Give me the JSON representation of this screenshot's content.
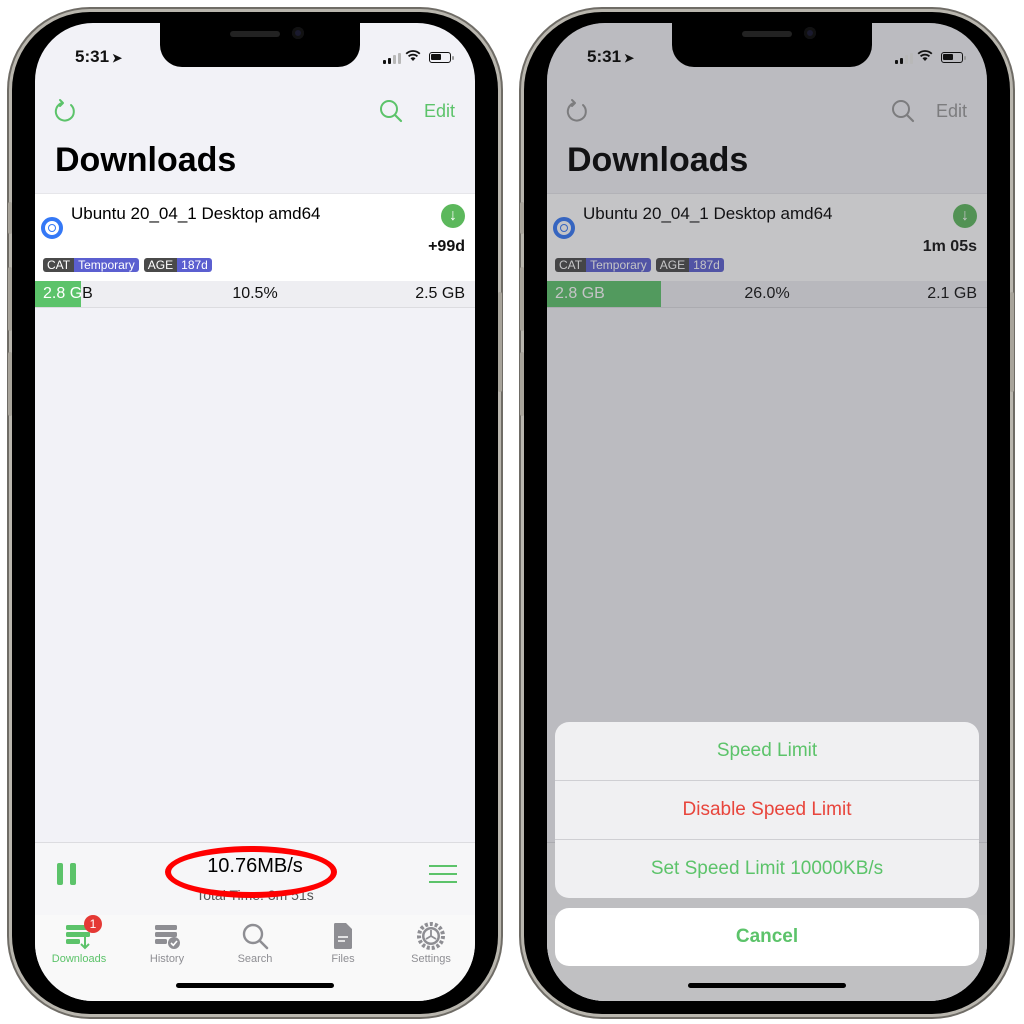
{
  "colors": {
    "accent": "#5cc36a",
    "destructive": "#e8453c",
    "radio_blue": "#3478f6",
    "tag_key": "#4a4a4a",
    "tag_value": "#5b5fd0",
    "badge_red": "#e53935",
    "annotation_red": "#ff0000"
  },
  "status_bar": {
    "time": "5:31",
    "location_icon": "location-arrow-icon",
    "signal_icon": "cellular-signal-icon",
    "wifi_icon": "wifi-icon",
    "battery_icon": "battery-icon"
  },
  "left_phone": {
    "nav": {
      "refresh_icon": "refresh-icon",
      "search_icon": "search-icon",
      "edit_label": "Edit"
    },
    "title": "Downloads",
    "download": {
      "name": "Ubuntu 20_04_1 Desktop amd64",
      "eta": "+99d",
      "tags": [
        {
          "key": "CAT",
          "value": "Temporary"
        },
        {
          "key": "AGE",
          "value": "187d"
        }
      ],
      "size_total": "2.8 GB",
      "size_total_prefix": "2.8 G",
      "size_total_suffix": "B",
      "percent_label": "10.5%",
      "progress_fraction": 0.105,
      "remaining": "2.5 GB"
    },
    "bottom_bar": {
      "speed": "10.76MB/s",
      "total_time": "Total Time: 3m 51s"
    },
    "tabs": [
      {
        "label": "Downloads",
        "icon": "downloads-icon",
        "badge": "1",
        "active": true
      },
      {
        "label": "History",
        "icon": "history-icon",
        "active": false
      },
      {
        "label": "Search",
        "icon": "search-icon",
        "active": false
      },
      {
        "label": "Files",
        "icon": "files-icon",
        "active": false
      },
      {
        "label": "Settings",
        "icon": "settings-icon",
        "active": false
      }
    ]
  },
  "right_phone": {
    "nav": {
      "edit_label": "Edit"
    },
    "title": "Downloads",
    "download": {
      "name": "Ubuntu 20_04_1 Desktop amd64",
      "eta": "1m 05s",
      "tags": [
        {
          "key": "CAT",
          "value": "Temporary"
        },
        {
          "key": "AGE",
          "value": "187d"
        }
      ],
      "size_total": "2.8 GB",
      "percent_label": "26.0%",
      "progress_fraction": 0.26,
      "remaining": "2.1 GB"
    },
    "action_sheet": {
      "items": [
        {
          "label": "Speed Limit",
          "style": "default"
        },
        {
          "label": "Disable Speed Limit",
          "style": "destructive"
        },
        {
          "label": "Set Speed Limit 10000KB/s",
          "style": "default"
        }
      ],
      "cancel_label": "Cancel"
    }
  }
}
